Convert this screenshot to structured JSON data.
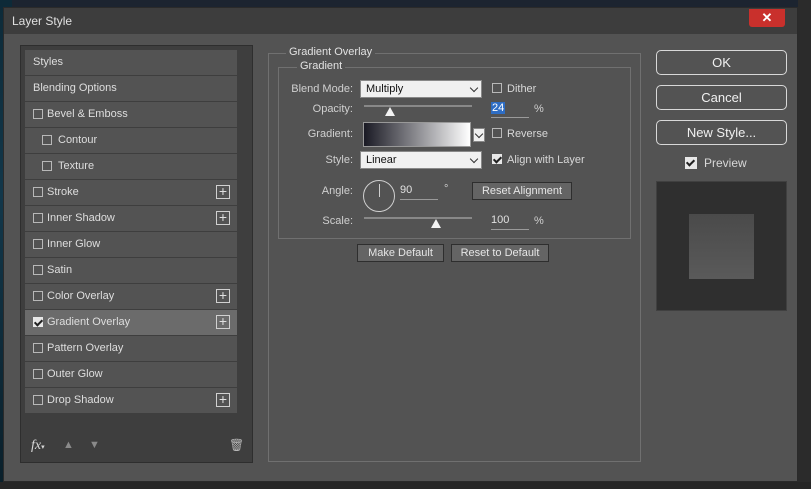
{
  "window": {
    "title": "Layer Style",
    "close_label": "✕"
  },
  "styles_list": [
    {
      "label": "Styles",
      "checkbox": false,
      "checked": false,
      "indent": false,
      "plus": false,
      "selected": false
    },
    {
      "label": "Blending Options",
      "checkbox": false,
      "checked": false,
      "indent": false,
      "plus": false,
      "selected": false
    },
    {
      "label": "Bevel & Emboss",
      "checkbox": true,
      "checked": false,
      "indent": false,
      "plus": false,
      "selected": false
    },
    {
      "label": "Contour",
      "checkbox": true,
      "checked": false,
      "indent": true,
      "plus": false,
      "selected": false
    },
    {
      "label": "Texture",
      "checkbox": true,
      "checked": false,
      "indent": true,
      "plus": false,
      "selected": false
    },
    {
      "label": "Stroke",
      "checkbox": true,
      "checked": false,
      "indent": false,
      "plus": true,
      "selected": false
    },
    {
      "label": "Inner Shadow",
      "checkbox": true,
      "checked": false,
      "indent": false,
      "plus": true,
      "selected": false
    },
    {
      "label": "Inner Glow",
      "checkbox": true,
      "checked": false,
      "indent": false,
      "plus": false,
      "selected": false
    },
    {
      "label": "Satin",
      "checkbox": true,
      "checked": false,
      "indent": false,
      "plus": false,
      "selected": false
    },
    {
      "label": "Color Overlay",
      "checkbox": true,
      "checked": false,
      "indent": false,
      "plus": true,
      "selected": false
    },
    {
      "label": "Gradient Overlay",
      "checkbox": true,
      "checked": true,
      "indent": false,
      "plus": true,
      "selected": true
    },
    {
      "label": "Pattern Overlay",
      "checkbox": true,
      "checked": false,
      "indent": false,
      "plus": false,
      "selected": false
    },
    {
      "label": "Outer Glow",
      "checkbox": true,
      "checked": false,
      "indent": false,
      "plus": false,
      "selected": false
    },
    {
      "label": "Drop Shadow",
      "checkbox": true,
      "checked": false,
      "indent": false,
      "plus": true,
      "selected": false
    }
  ],
  "toolbar": {
    "fx_label": "fx",
    "fx_sub": "▾",
    "up_icon": "▲",
    "down_icon": "▼",
    "trash_icon": "🗑"
  },
  "gradient_overlay": {
    "section_title": "Gradient Overlay",
    "subsection_title": "Gradient",
    "blend_mode_label": "Blend Mode:",
    "blend_mode_value": "Multiply",
    "dither_label": "Dither",
    "dither_checked": false,
    "opacity_label": "Opacity:",
    "opacity_value": "24",
    "opacity_percent": 24,
    "percent_sign": "%",
    "gradient_label": "Gradient:",
    "reverse_label": "Reverse",
    "reverse_checked": false,
    "style_label": "Style:",
    "style_value": "Linear",
    "align_label": "Align with Layer",
    "align_checked": true,
    "angle_label": "Angle:",
    "angle_value": "90",
    "degree_sign": "°",
    "reset_alignment_label": "Reset Alignment",
    "scale_label": "Scale:",
    "scale_value": "100",
    "scale_percent": 100
  },
  "bottom_buttons": {
    "make_default": "Make Default",
    "reset_default": "Reset to Default"
  },
  "actions": {
    "ok": "OK",
    "cancel": "Cancel",
    "new_style": "New Style...",
    "preview_label": "Preview",
    "preview_checked": true
  },
  "colors": {
    "dialog_bg": "#535353",
    "selected_item": "#6b6b6b",
    "close_red": "#c9302c",
    "highlight_blue": "#2e6dc4"
  }
}
